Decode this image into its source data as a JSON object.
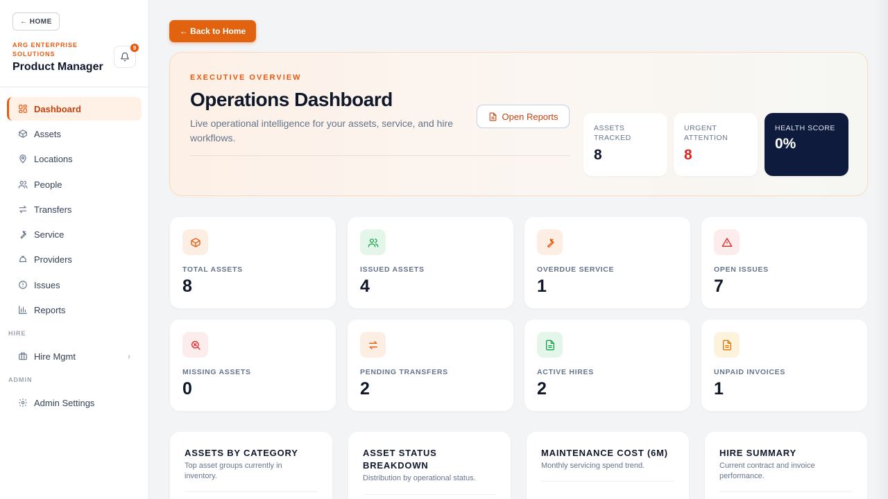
{
  "sidebar": {
    "home_label": "← HOME",
    "org_name": "ARG ENTERPRISE SOLUTIONS",
    "role": "Product Manager",
    "notifications_count": "9",
    "items": [
      {
        "label": "Dashboard",
        "icon": "dashboard-icon"
      },
      {
        "label": "Assets",
        "icon": "box-icon"
      },
      {
        "label": "Locations",
        "icon": "map-pin-icon"
      },
      {
        "label": "People",
        "icon": "users-icon"
      },
      {
        "label": "Transfers",
        "icon": "transfer-icon"
      },
      {
        "label": "Service",
        "icon": "wrench-icon"
      },
      {
        "label": "Providers",
        "icon": "provider-icon"
      },
      {
        "label": "Issues",
        "icon": "alert-circle-icon"
      },
      {
        "label": "Reports",
        "icon": "bar-chart-icon"
      }
    ],
    "hire_section": "HIRE",
    "hire_item": "Hire Mgmt",
    "admin_section": "ADMIN",
    "admin_item": "Admin Settings"
  },
  "main": {
    "back_label": "← Back to Home",
    "hero": {
      "eyebrow": "EXECUTIVE OVERVIEW",
      "title": "Operations Dashboard",
      "subtitle": "Live operational intelligence for your assets, service, and hire workflows.",
      "open_reports": "Open Reports",
      "stats": [
        {
          "label": "ASSETS TRACKED",
          "value": "8"
        },
        {
          "label": "URGENT ATTENTION",
          "value": "8"
        },
        {
          "label": "HEALTH SCORE",
          "value": "0%"
        }
      ]
    },
    "kpis": [
      {
        "label": "TOTAL ASSETS",
        "value": "8",
        "icon": "box-icon"
      },
      {
        "label": "ISSUED ASSETS",
        "value": "4",
        "icon": "users-icon"
      },
      {
        "label": "OVERDUE SERVICE",
        "value": "1",
        "icon": "wrench-icon"
      },
      {
        "label": "OPEN ISSUES",
        "value": "7",
        "icon": "warning-triangle-icon"
      },
      {
        "label": "MISSING ASSETS",
        "value": "0",
        "icon": "search-x-icon"
      },
      {
        "label": "PENDING TRANSFERS",
        "value": "2",
        "icon": "transfer-icon"
      },
      {
        "label": "ACTIVE HIRES",
        "value": "2",
        "icon": "document-icon"
      },
      {
        "label": "UNPAID INVOICES",
        "value": "1",
        "icon": "invoice-icon"
      }
    ],
    "panels": [
      {
        "title": "ASSETS BY CATEGORY",
        "subtitle": "Top asset groups currently in inventory."
      },
      {
        "title": "ASSET STATUS BREAKDOWN",
        "subtitle": "Distribution by operational status."
      },
      {
        "title": "MAINTENANCE COST (6M)",
        "subtitle": "Monthly servicing spend trend."
      },
      {
        "title": "HIRE SUMMARY",
        "subtitle": "Current contract and invoice performance."
      }
    ]
  },
  "colors": {
    "accent": "#ea580c",
    "dark_card": "#0f1b3d",
    "urgent": "#dc2626"
  }
}
